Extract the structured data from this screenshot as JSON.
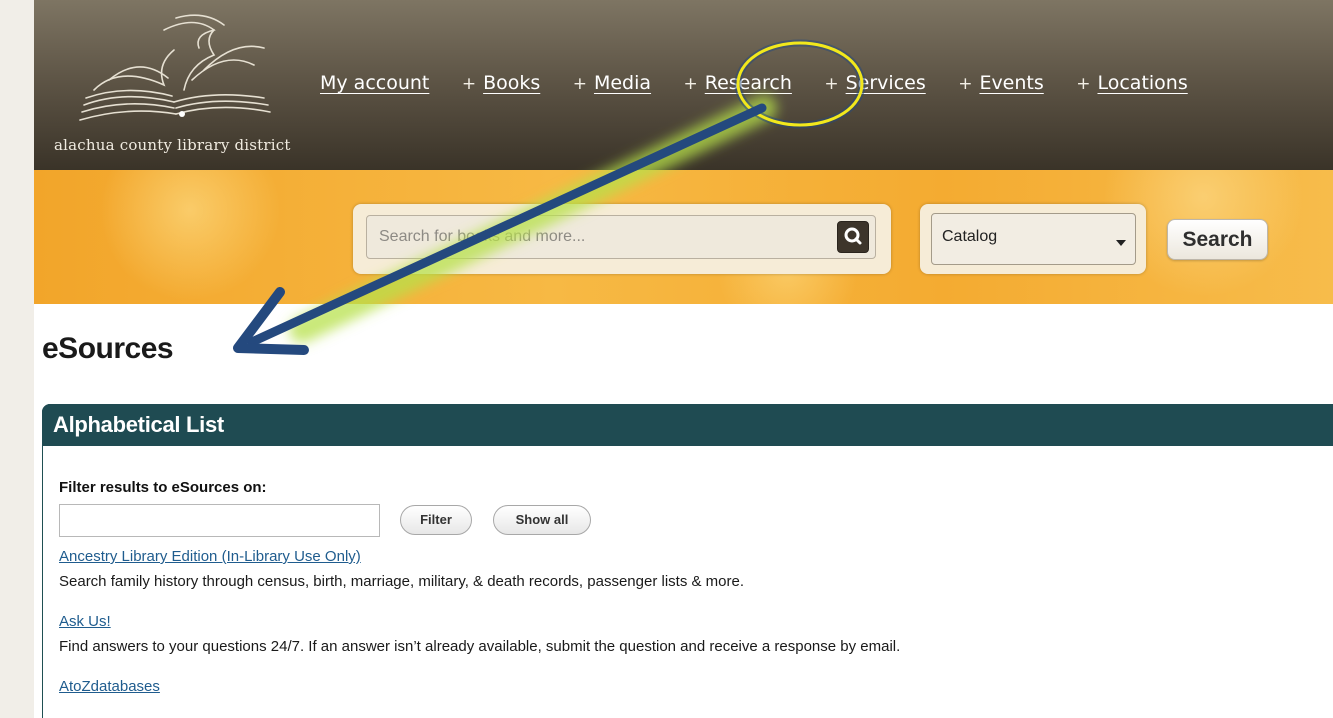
{
  "header": {
    "logo_text": "alachua county library district",
    "nav": [
      {
        "plus": "",
        "label": "My account"
      },
      {
        "plus": "+",
        "label": "Books"
      },
      {
        "plus": "+",
        "label": "Media"
      },
      {
        "plus": "+",
        "label": "Research"
      },
      {
        "plus": "+",
        "label": "Services"
      },
      {
        "plus": "+",
        "label": "Events"
      },
      {
        "plus": "+",
        "label": "Locations"
      }
    ]
  },
  "search": {
    "placeholder": "Search for books and more...",
    "scope_value": "Catalog",
    "button_label": "Search"
  },
  "page": {
    "title": "eSources"
  },
  "panel": {
    "title": "Alphabetical List",
    "filter_label": "Filter results to eSources on:",
    "filter_button": "Filter",
    "show_all_button": "Show all",
    "items": [
      {
        "link": "Ancestry Library Edition (In-Library Use Only)",
        "description": "Search family history through census, birth, marriage, military, & death records, passenger lists & more."
      },
      {
        "link": "Ask Us!",
        "description": "Find answers to your questions 24/7. If an answer isn’t already available, submit the question and receive a response by email."
      },
      {
        "link": "AtoZdatabases",
        "description": ""
      }
    ]
  },
  "colors": {
    "nav_band": "#5f5647",
    "search_band": "#f4ab31",
    "panel_header": "#1f4b52",
    "link": "#1f5c8e",
    "highlight_circle": "#f2e81c",
    "arrow": "#24497e",
    "arrow_glow": "#b7e04a"
  }
}
